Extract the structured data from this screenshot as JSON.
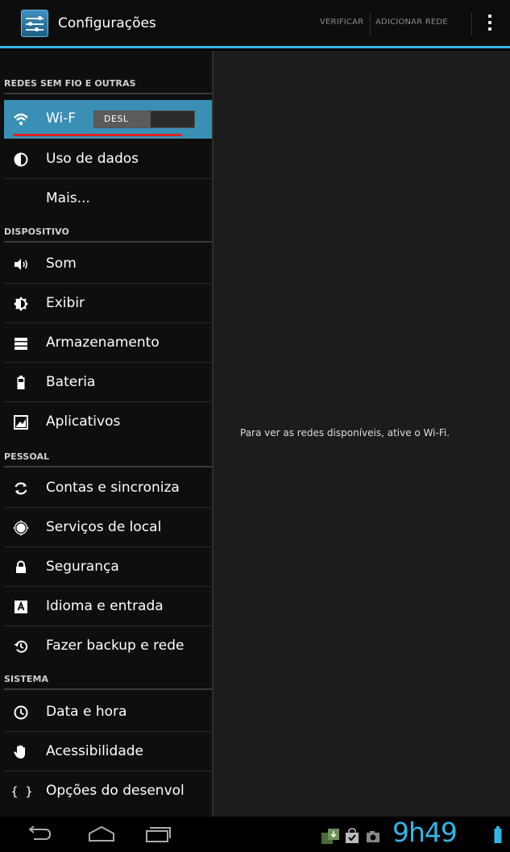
{
  "actionbar": {
    "title": "Configurações",
    "actions": [
      "VERIFICAR",
      "ADICIONAR REDE"
    ],
    "overflow_icon": "overflow-menu-icon"
  },
  "sidebar": {
    "wifi_toggle": "DESL",
    "sections": [
      {
        "header": "REDES SEM FIO E OUTRAS",
        "items": [
          {
            "label": "Wi-F",
            "icon": "wifi-icon",
            "selected": true
          },
          {
            "label": "Uso de dados",
            "icon": "data-usage-icon"
          },
          {
            "label": "Mais...",
            "icon": ""
          }
        ]
      },
      {
        "header": "DISPOSITIVO",
        "items": [
          {
            "label": "Som",
            "icon": "sound-icon"
          },
          {
            "label": "Exibir",
            "icon": "display-icon"
          },
          {
            "label": "Armazenamento",
            "icon": "storage-icon"
          },
          {
            "label": "Bateria",
            "icon": "battery-icon"
          },
          {
            "label": "Aplicativos",
            "icon": "apps-icon"
          }
        ]
      },
      {
        "header": "PESSOAL",
        "items": [
          {
            "label": "Contas e sincroniza",
            "icon": "sync-icon"
          },
          {
            "label": "Serviços de local",
            "icon": "location-icon"
          },
          {
            "label": "Segurança",
            "icon": "lock-icon"
          },
          {
            "label": "Idioma e entrada",
            "icon": "language-icon"
          },
          {
            "label": "Fazer backup e rede",
            "icon": "backup-icon"
          }
        ]
      },
      {
        "header": "SISTEMA",
        "items": [
          {
            "label": "Data e hora",
            "icon": "clock-icon"
          },
          {
            "label": "Acessibilidade",
            "icon": "hand-icon"
          },
          {
            "label": "Opções do desenvol",
            "icon": "braces-icon"
          }
        ]
      }
    ]
  },
  "detail": {
    "message": "Para ver as redes disponíveis, ative o Wi-Fi."
  },
  "statusbar": {
    "time": "9h49"
  },
  "colors": {
    "accent": "#33b5e5",
    "selected_item": "#3a8fb5",
    "highlight": "#e02020"
  }
}
